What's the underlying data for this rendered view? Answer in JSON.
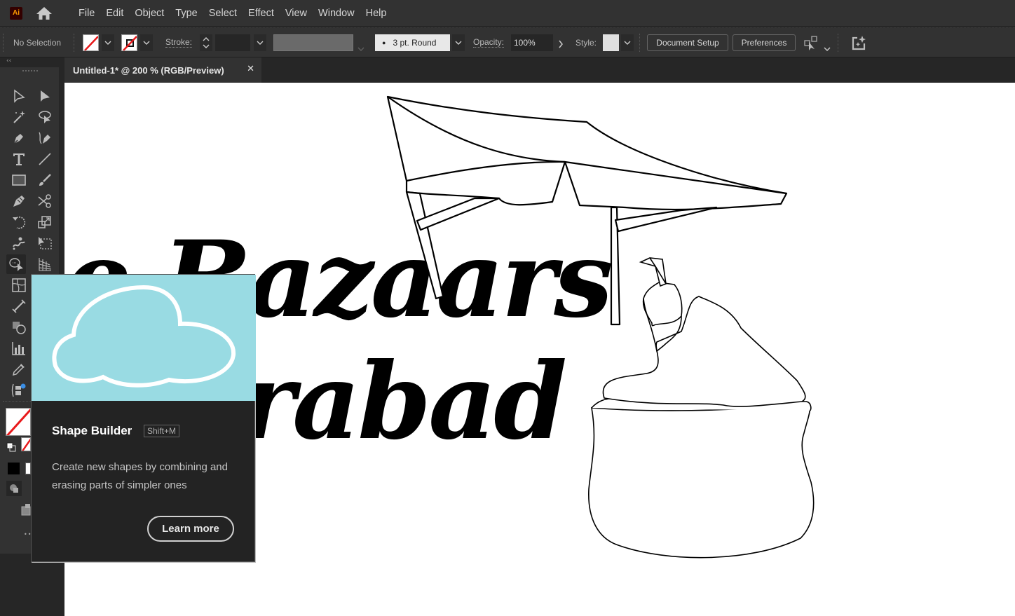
{
  "app": {
    "logo_text": "Ai"
  },
  "menu": {
    "items": [
      "File",
      "Edit",
      "Object",
      "Type",
      "Select",
      "Effect",
      "View",
      "Window",
      "Help"
    ]
  },
  "control_bar": {
    "selection_status": "No Selection",
    "stroke_label": "Stroke:",
    "brush_label": "3 pt. Round",
    "opacity_label": "Opacity:",
    "opacity_value": "100%",
    "style_label": "Style:",
    "document_setup_label": "Document Setup",
    "preferences_label": "Preferences"
  },
  "document_tab": {
    "title": "Untitled-1* @ 200 % (RGB/Preview)",
    "close_glyph": "✕"
  },
  "toolbar": {
    "collapse_glyph": "‹‹",
    "tools": [
      {
        "name": "selection-tool"
      },
      {
        "name": "direct-selection-tool"
      },
      {
        "name": "magic-wand-tool"
      },
      {
        "name": "lasso-tool"
      },
      {
        "name": "pen-tool"
      },
      {
        "name": "curvature-tool"
      },
      {
        "name": "type-tool"
      },
      {
        "name": "line-segment-tool"
      },
      {
        "name": "rectangle-tool"
      },
      {
        "name": "paintbrush-tool"
      },
      {
        "name": "shaper-tool"
      },
      {
        "name": "scissors-tool"
      },
      {
        "name": "rotate-tool"
      },
      {
        "name": "scale-tool"
      },
      {
        "name": "warp-tool"
      },
      {
        "name": "free-transform-tool"
      },
      {
        "name": "shape-builder-tool",
        "active": true
      },
      {
        "name": "perspective-grid-tool"
      },
      {
        "name": "mesh-tool"
      },
      {
        "name": "blend-tool"
      },
      {
        "name": "symbol-sprayer-tool"
      },
      {
        "name": "column-graph-tool"
      },
      {
        "name": "eyedropper-tool"
      },
      {
        "name": "artboard-tool"
      }
    ],
    "more_glyph": "•••"
  },
  "canvas": {
    "headline_line1": "e Bazaars",
    "headline_line2": "rabad"
  },
  "tooltip": {
    "title": "Shape Builder",
    "shortcut": "Shift+M",
    "description": "Create new shapes by combining and erasing parts of simpler ones",
    "learn_more_label": "Learn more",
    "image_color": "#99dbe3"
  },
  "colors": {
    "accent_none_stroke": "#e8191b",
    "tooltip_bg": "#232323",
    "menubar_bg": "#323232"
  }
}
